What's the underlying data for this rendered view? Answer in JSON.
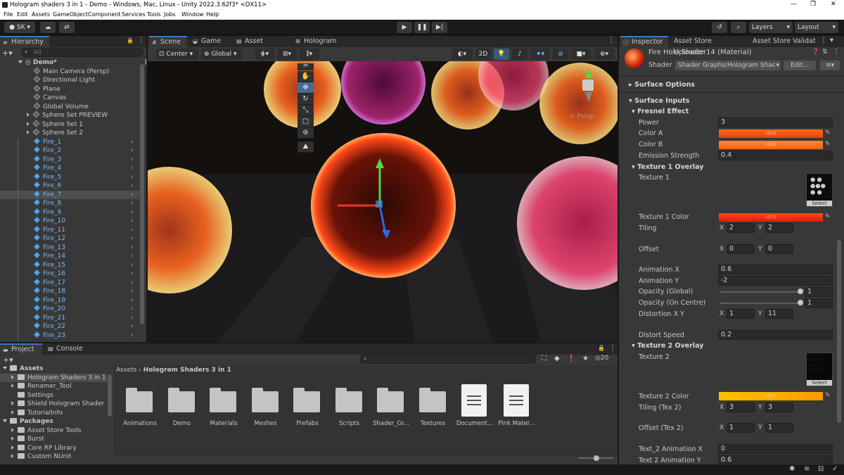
{
  "window": {
    "title": "Hologram shaders 3 in 1 - Demo - Windows, Mac, Linux - Unity 2022.3.62f3* <DX11>"
  },
  "menu": [
    "File",
    "Edit",
    "Assets",
    "GameObject",
    "Component",
    "Services",
    "Tools",
    "Jobs",
    "Window",
    "Help"
  ],
  "toolbar": {
    "account": "SK",
    "layers": "Layers",
    "layout": "Layout"
  },
  "hierarchy": {
    "tab": "Hierarchy",
    "search_placeholder": "All",
    "scene": "Demo*",
    "objects": [
      "Main Camera (Persp)",
      "Directional Light",
      "Plane",
      "Canvas",
      "Global Volume"
    ],
    "sets": [
      "Sphere Set PREVIEW",
      "Sphere Set 1",
      "Sphere Set 2"
    ],
    "fires": [
      "Fire_1",
      "Fire_2",
      "Fire_3",
      "Fire_4",
      "Fire_5",
      "Fire_6",
      "Fire_7",
      "Fire_8",
      "Fire_9",
      "Fire_10",
      "Fire_11",
      "Fire_12",
      "Fire_13",
      "Fire_14",
      "Fire_15",
      "Fire_16",
      "Fire_17",
      "Fire_18",
      "Fire_19",
      "Fire_20",
      "Fire_21",
      "Fire_22",
      "Fire_23"
    ],
    "selected": "Fire_7"
  },
  "scene_tabs": [
    "Scene",
    "Game",
    "Asset Store",
    "Hologram Shader"
  ],
  "scene_toolbar": {
    "pivot": "Center",
    "space": "Global",
    "mode2d": "2D",
    "persp": "< Persp"
  },
  "project": {
    "tabs": [
      "Project",
      "Console"
    ],
    "tree_header": "Assets",
    "tree": [
      "Hologram Shaders 3 in 1",
      "Renamer_Tool",
      "Settings",
      "Shield Hologram Shader",
      "TutorialInfo"
    ],
    "packages_header": "Packages",
    "packages": [
      "Asset Store Tools",
      "Burst",
      "Core RP Library",
      "Custom NUnit"
    ],
    "breadcrumb": [
      "Assets",
      "Hologram Shaders 3 in 1"
    ],
    "count": "20",
    "assets": [
      "Animations",
      "Demo",
      "Materials",
      "Meshes",
      "Prefabs",
      "Scripts",
      "Shader_Gr...",
      "Textures",
      "Document...",
      "Pink Mater..."
    ]
  },
  "inspector": {
    "tabs": [
      "Inspector",
      "Asset Store Uploader",
      "Asset Store Validat"
    ],
    "material": "Fire Holo Shader14 (Material)",
    "shader_label": "Shader",
    "shader": "Shader Graphs/Hologram Shac",
    "edit": "Edit...",
    "sections": {
      "surface_options": "Surface Options",
      "surface_inputs": "Surface Inputs",
      "fresnel": "Fresnel Effect",
      "tex1": "Texture 1 Overlay",
      "tex2": "Texture 2 Overlay"
    },
    "props": {
      "power_l": "Power",
      "power_v": "3",
      "colorA_l": "Color A",
      "colorB_l": "Color B",
      "hdr": "HDR",
      "emission_l": "Emission Strength",
      "emission_v": "0.4",
      "texture1_l": "Texture 1",
      "select": "Select",
      "texture1color_l": "Texture 1 Color",
      "tiling_l": "Tiling",
      "tiling_x": "2",
      "tiling_y": "2",
      "offset_l": "Offset",
      "offset_x": "0",
      "offset_y": "0",
      "animx_l": "Animation X",
      "animx_v": "0.6",
      "animy_l": "Animation Y",
      "animy_v": "-2",
      "opg_l": "Opacity (Global)",
      "opg_v": "1",
      "opc_l": "Opacity (On Centre)",
      "opc_v": "1",
      "dist_l": "Distortion X Y",
      "dist_x": "1",
      "dist_y": "11",
      "dspeed_l": "Distort Speed",
      "dspeed_v": "0.2",
      "texture2_l": "Texture 2",
      "texture2color_l": "Texture 2 Color",
      "tiling2_l": "Tiling (Tex 2)",
      "tiling2_x": "3",
      "tiling2_y": "3",
      "offset2_l": "Offset (Tex 2)",
      "offset2_x": "1",
      "offset2_y": "1",
      "t2ax_l": "Text_2 Animation X",
      "t2ax_v": "0",
      "t2ay_l": "Text 2 Animation Y",
      "t2ay_v": "0.6",
      "x": "X",
      "y": "Y"
    }
  },
  "colors": {
    "accent": "#3a79bb",
    "colorA": "#ff5a10",
    "colorB": "#ff7a28",
    "tex1color": "#ff3a10",
    "tex2color": "#ffb400"
  }
}
